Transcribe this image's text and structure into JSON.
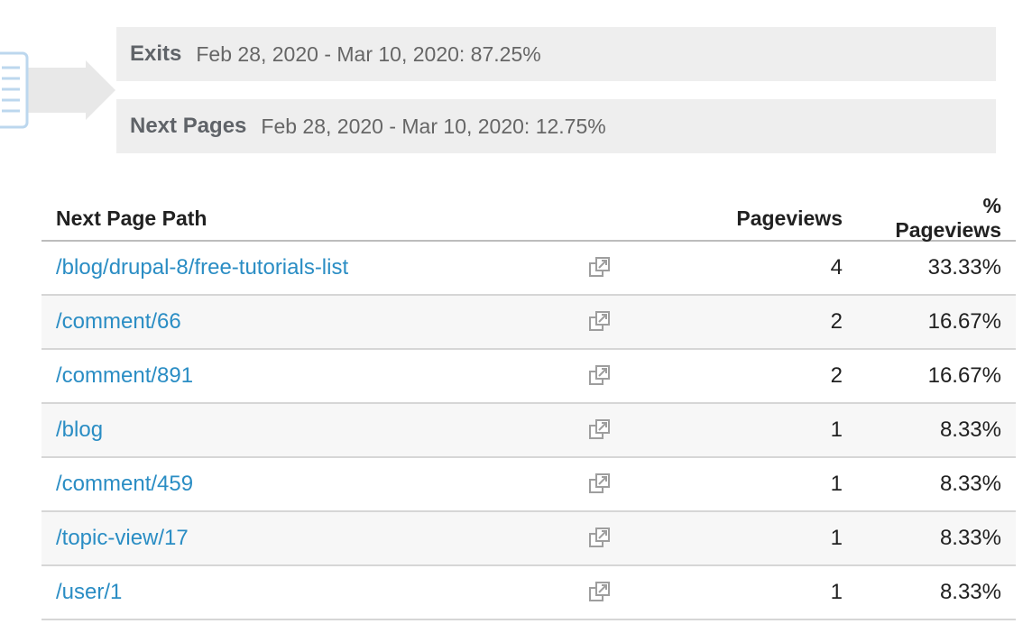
{
  "summary": {
    "exits": {
      "title": "Exits",
      "value": "Feb 28, 2020 - Mar 10, 2020: 87.25%"
    },
    "next_pages": {
      "title": "Next Pages",
      "value": "Feb 28, 2020 - Mar 10, 2020: 12.75%"
    }
  },
  "table": {
    "headers": {
      "path": "Next Page Path",
      "pageviews": "Pageviews",
      "pct_pageviews": "% Pageviews"
    },
    "rows": [
      {
        "path": "/blog/drupal-8/free-tutorials-list",
        "pageviews": "4",
        "pct": "33.33%"
      },
      {
        "path": "/comment/66",
        "pageviews": "2",
        "pct": "16.67%"
      },
      {
        "path": "/comment/891",
        "pageviews": "2",
        "pct": "16.67%"
      },
      {
        "path": "/blog",
        "pageviews": "1",
        "pct": "8.33%"
      },
      {
        "path": "/comment/459",
        "pageviews": "1",
        "pct": "8.33%"
      },
      {
        "path": "/topic-view/17",
        "pageviews": "1",
        "pct": "8.33%"
      },
      {
        "path": "/user/1",
        "pageviews": "1",
        "pct": "8.33%"
      }
    ]
  },
  "icons": {
    "page": "page-icon",
    "flow_arrow": "flow-arrow-icon",
    "open_external": "open-in-new-window-icon"
  },
  "colors": {
    "link": "#2a8dc4",
    "summary_bg": "#eeeeee",
    "summary_title": "#5f6368",
    "row_alt_bg": "#f7f7f7"
  }
}
